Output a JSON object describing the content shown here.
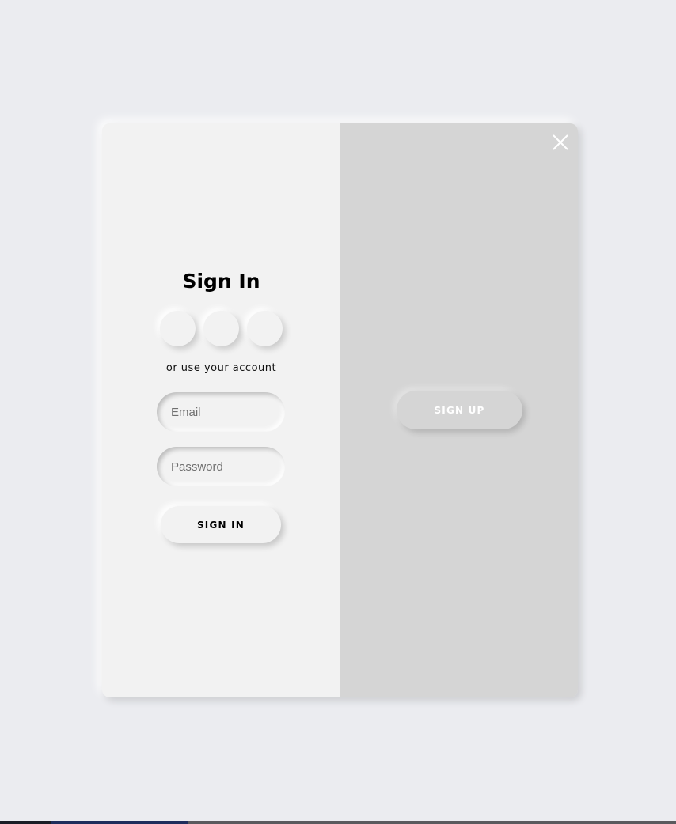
{
  "signin": {
    "title": "Sign In",
    "social_buttons": [
      "social-1",
      "social-2",
      "social-3"
    ],
    "alt_text": "or use your account",
    "email_placeholder": "Email",
    "password_placeholder": "Password",
    "submit_label": "SIGN IN"
  },
  "overlay": {
    "signup_label": "SIGN UP",
    "close_icon": "close-icon"
  },
  "colors": {
    "page_background": "#ebecf0",
    "left_panel": "#f2f2f2",
    "right_panel": "#d5d5d5"
  }
}
